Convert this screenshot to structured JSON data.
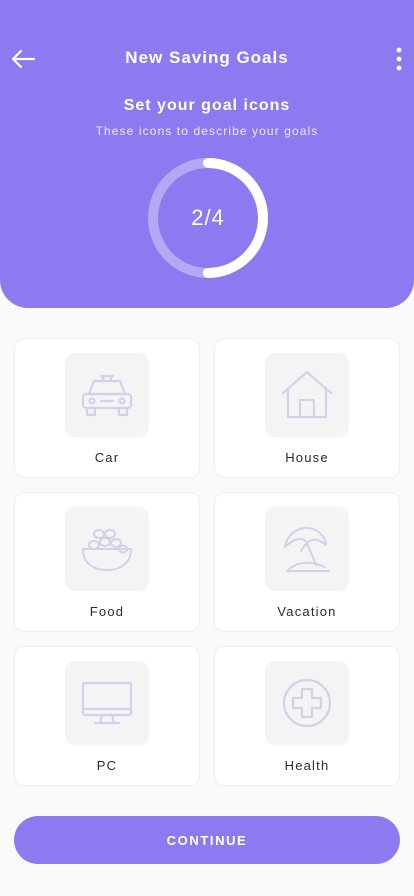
{
  "header": {
    "title": "New Saving Goals",
    "subtitle": "Set your goal icons",
    "caption": "These icons to describe your goals",
    "progress_text": "2/4",
    "progress_fraction": 0.5,
    "back_icon": "arrow-left-icon",
    "menu_icon": "more-vertical-icon"
  },
  "goals": [
    {
      "label": "Car",
      "icon": "car-icon"
    },
    {
      "label": "House",
      "icon": "house-icon"
    },
    {
      "label": "Food",
      "icon": "food-bowl-icon"
    },
    {
      "label": "Vacation",
      "icon": "beach-umbrella-icon"
    },
    {
      "label": "PC",
      "icon": "monitor-icon"
    },
    {
      "label": "Health",
      "icon": "medical-cross-icon"
    }
  ],
  "continue_label": "CONTINUE",
  "colors": {
    "accent": "#8c7af0",
    "icon_stroke": "#d4d0ea",
    "icon_tile": "#f4f4f5",
    "background": "#fafafa"
  }
}
